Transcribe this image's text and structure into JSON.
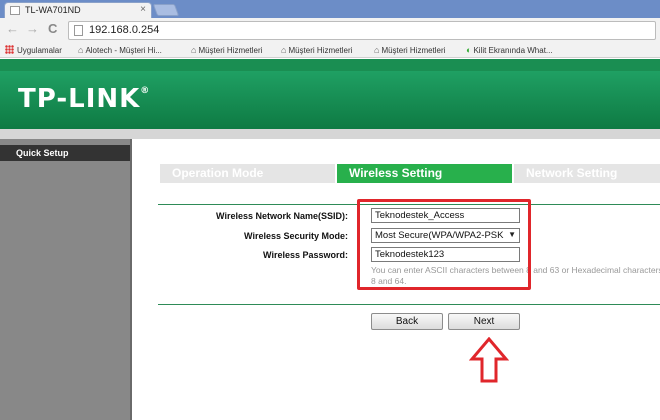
{
  "browser": {
    "tab_title": "TL-WA701ND",
    "tab_close": "×",
    "url": "192.168.0.254",
    "nav": {
      "back": "←",
      "forward": "→",
      "reload": "C"
    },
    "bookmarks": [
      {
        "label": "Uygulamalar",
        "icon": "apps-icon"
      },
      {
        "label": "Alotech - Müşteri Hi...",
        "icon": "bookmark-icon"
      },
      {
        "label": "Müşteri Hizmetleri",
        "icon": "bookmark-icon"
      },
      {
        "label": "Müşteri Hizmetleri",
        "icon": "bookmark-icon"
      },
      {
        "label": "Müşteri Hizmetleri",
        "icon": "bookmark-icon"
      },
      {
        "label": "Kilit Ekranında What...",
        "icon": "whatsapp-icon"
      }
    ]
  },
  "router": {
    "brand": "TP-LINK",
    "brand_mark": "®",
    "colors": {
      "header": "#138a4e",
      "active_step": "#28b04c",
      "highlight": "#e0262b"
    }
  },
  "sidebar": {
    "items": [
      {
        "label": "Quick Setup"
      }
    ]
  },
  "wizard": {
    "steps": [
      {
        "label": "Operation Mode",
        "active": false
      },
      {
        "label": "Wireless Setting",
        "active": true
      },
      {
        "label": "Network Setting",
        "active": false
      }
    ],
    "fields": {
      "ssid": {
        "label": "Wireless Network Name(SSID):",
        "value": "Teknodestek_Access"
      },
      "security": {
        "label": "Wireless Security Mode:",
        "value": "Most Secure(WPA/WPA2-PSK"
      },
      "password": {
        "label": "Wireless Password:",
        "value": "Teknodestek123"
      }
    },
    "hint_line1": "You can enter ASCII characters between 8 and 63 or Hexadecimal characters",
    "hint_line2": "8 and 64.",
    "buttons": {
      "back": "Back",
      "next": "Next"
    }
  }
}
